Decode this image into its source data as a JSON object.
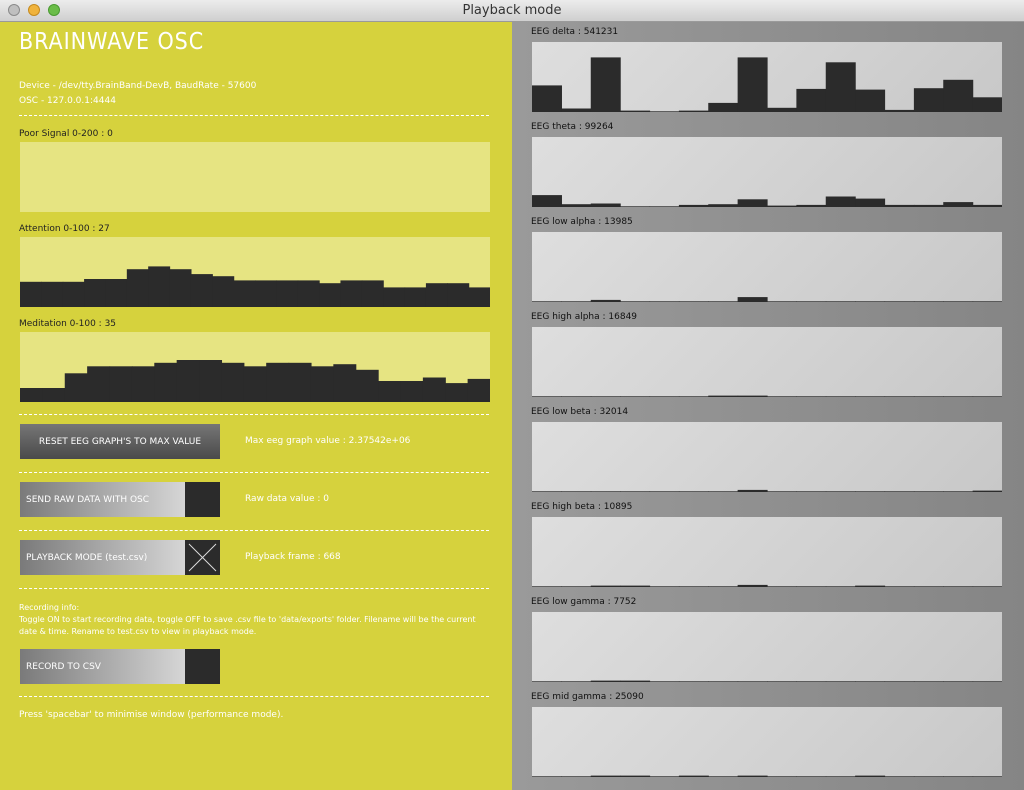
{
  "window": {
    "title": "Playback mode"
  },
  "app": {
    "title": "BRAINWAVE OSC",
    "device_line": "Device - /dev/tty.BrainBand-DevB, BaudRate - 57600",
    "osc_line": "OSC - 127.0.0.1:4444"
  },
  "graphs": {
    "poor_signal": {
      "label": "Poor Signal 0-200 : 0",
      "max": 200,
      "values": []
    },
    "attention": {
      "label": "Attention 0-100 : 27",
      "max": 100,
      "values": [
        36,
        36,
        36,
        40,
        40,
        54,
        58,
        54,
        47,
        44,
        38,
        38,
        38,
        38,
        34,
        38,
        38,
        28,
        28,
        34,
        34,
        28
      ]
    },
    "meditation": {
      "label": "Meditation 0-100 : 35",
      "max": 100,
      "values": [
        20,
        20,
        41,
        51,
        51,
        51,
        56,
        60,
        60,
        56,
        51,
        56,
        56,
        51,
        54,
        46,
        30,
        30,
        35,
        27,
        33
      ]
    }
  },
  "controls": {
    "reset_button": "RESET EEG GRAPH'S TO MAX VALUE",
    "max_eeg_value": "Max eeg graph value : 2.37542e+06",
    "send_raw_button": "SEND RAW DATA WITH OSC",
    "raw_value": "Raw data value : 0",
    "playback_button": "PLAYBACK MODE (test.csv)",
    "playback_frame": "Playback frame : 668",
    "recording_info": "Recording info:\nToggle ON to start recording data, toggle OFF to save .csv file to 'data/exports' folder. Filename will be the current date & time. Rename to test.csv to view in playback mode.",
    "record_button": "RECORD TO CSV",
    "footer": "Press 'spacebar' to minimise window (performance mode)."
  },
  "toggles": {
    "send_raw": false,
    "playback": true,
    "record": false
  },
  "eeg": [
    {
      "label": "EEG delta : 541231",
      "values": [
        0.38,
        0.05,
        0.78,
        0.02,
        0.01,
        0.02,
        0.13,
        0.78,
        0.06,
        0.33,
        0.71,
        0.32,
        0.03,
        0.34,
        0.46,
        0.21
      ]
    },
    {
      "label": "EEG theta : 99264",
      "values": [
        0.17,
        0.04,
        0.05,
        0.01,
        0.01,
        0.03,
        0.04,
        0.11,
        0.02,
        0.03,
        0.15,
        0.12,
        0.03,
        0.03,
        0.07,
        0.03
      ]
    },
    {
      "label": "EEG low alpha : 13985",
      "values": [
        0.01,
        0.01,
        0.03,
        0.01,
        0.01,
        0.01,
        0.01,
        0.07,
        0.01,
        0.01,
        0.01,
        0.01,
        0.01,
        0.01,
        0.01,
        0.01
      ]
    },
    {
      "label": "EEG high alpha : 16849",
      "values": [
        0.01,
        0.01,
        0.01,
        0.01,
        0.01,
        0.01,
        0.02,
        0.02,
        0.01,
        0.01,
        0.01,
        0.01,
        0.01,
        0.01,
        0.01,
        0.01
      ]
    },
    {
      "label": "EEG low beta : 32014",
      "values": [
        0.01,
        0.01,
        0.01,
        0.01,
        0.01,
        0.01,
        0.01,
        0.03,
        0.01,
        0.01,
        0.01,
        0.01,
        0.01,
        0.01,
        0.01,
        0.02
      ]
    },
    {
      "label": "EEG high beta : 10895",
      "values": [
        0.01,
        0.01,
        0.02,
        0.02,
        0.01,
        0.01,
        0.01,
        0.03,
        0.01,
        0.01,
        0.01,
        0.02,
        0.01,
        0.01,
        0.01,
        0.01
      ]
    },
    {
      "label": "EEG low gamma : 7752",
      "values": [
        0.01,
        0.01,
        0.02,
        0.02,
        0.01,
        0.01,
        0.01,
        0.01,
        0.01,
        0.01,
        0.01,
        0.01,
        0.01,
        0.01,
        0.01,
        0.01
      ]
    },
    {
      "label": "EEG mid gamma : 25090",
      "values": [
        0.01,
        0.01,
        0.02,
        0.02,
        0.01,
        0.02,
        0.01,
        0.02,
        0.01,
        0.01,
        0.01,
        0.02,
        0.01,
        0.01,
        0.01,
        0.01
      ]
    }
  ],
  "colors": {
    "panel": "#d6d23d",
    "graph_bg": "#e6e482",
    "bar": "#2b2b2b",
    "eeg_bg": "#d4d4d4"
  }
}
